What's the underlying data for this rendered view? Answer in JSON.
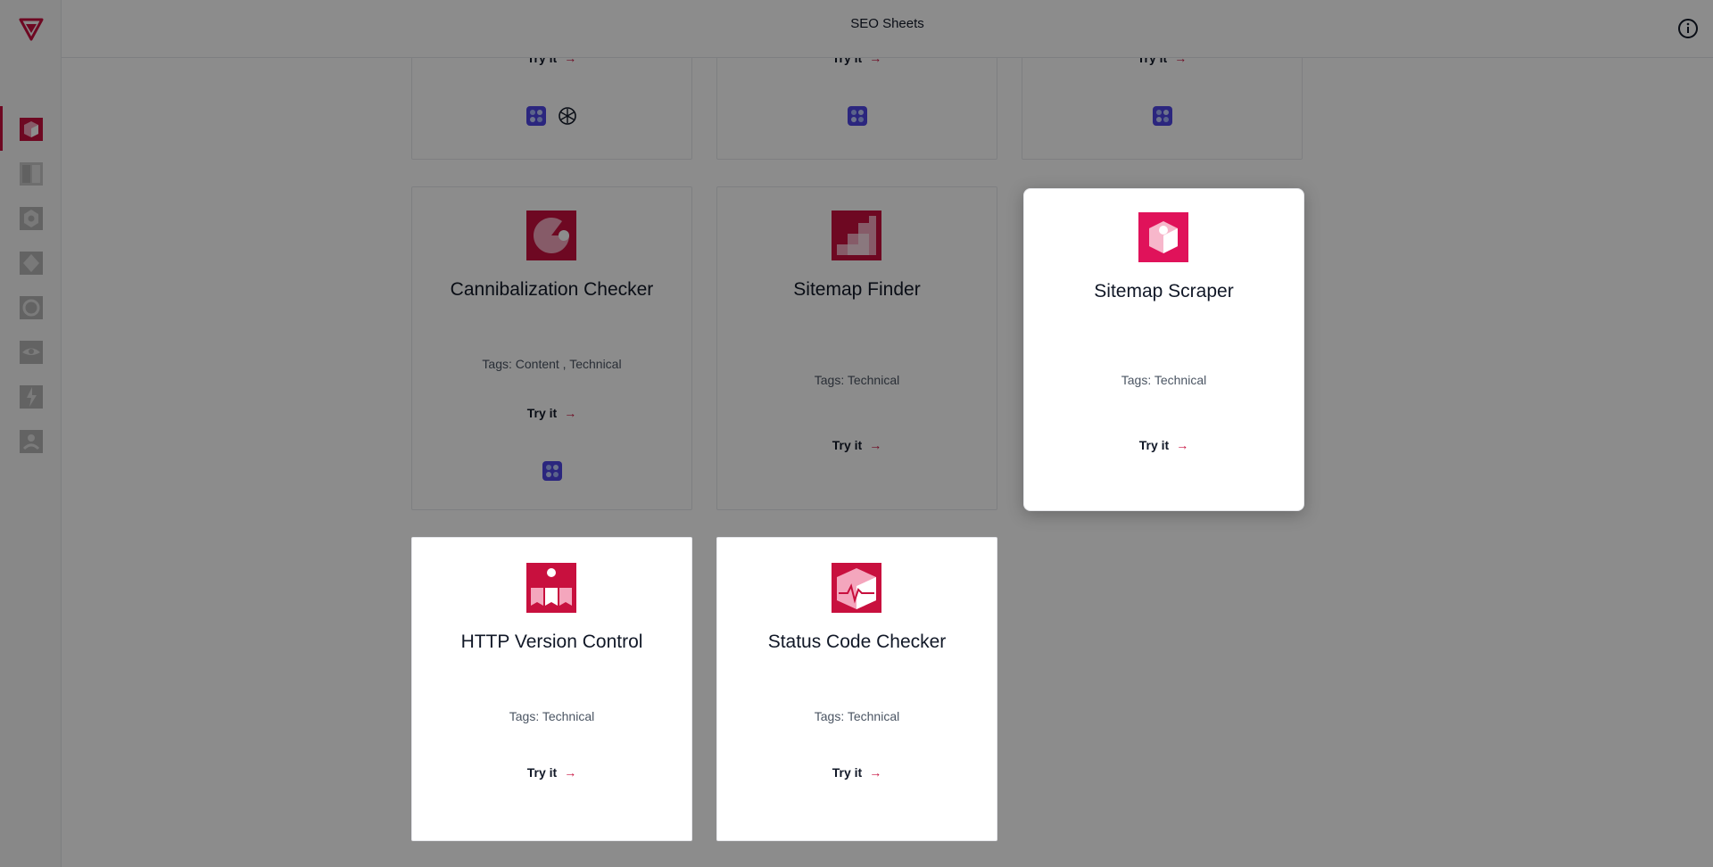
{
  "app": {
    "title": "SEO Sheets"
  },
  "icons": {
    "logo": "brand-logo-icon",
    "info": "info-icon",
    "nav": [
      "cube-icon",
      "columns-icon",
      "hexagon-icon",
      "diamond-icon",
      "circle-icon",
      "eye-icon",
      "bolt-icon",
      "face-icon"
    ]
  },
  "colors": {
    "accent": "#c8103e",
    "icon_bg": "#c8103e",
    "badge_blue": "#4f46e5"
  },
  "cards": {
    "top_row": [
      {
        "try_label": "Try it",
        "arrow": "→"
      },
      {
        "try_label": "Try it",
        "arrow": "→"
      },
      {
        "try_label": "Try it",
        "arrow": "→"
      }
    ],
    "cannibalization": {
      "title": "Cannibalization Checker",
      "tags": "Tags: Content , Technical",
      "try_label": "Try it",
      "arrow": "→"
    },
    "sitemap_finder": {
      "title": "Sitemap Finder",
      "tags": "Tags: Technical",
      "try_label": "Try it",
      "arrow": "→"
    },
    "sitemap_scraper": {
      "title": "Sitemap Scraper",
      "tags": "Tags: Technical",
      "try_label": "Try it",
      "arrow": "→"
    },
    "http_version": {
      "title": "HTTP Version Control",
      "tags": "Tags: Technical",
      "try_label": "Try it",
      "arrow": "→"
    },
    "status_code": {
      "title": "Status Code Checker",
      "tags": "Tags: Technical",
      "try_label": "Try it",
      "arrow": "→"
    }
  }
}
